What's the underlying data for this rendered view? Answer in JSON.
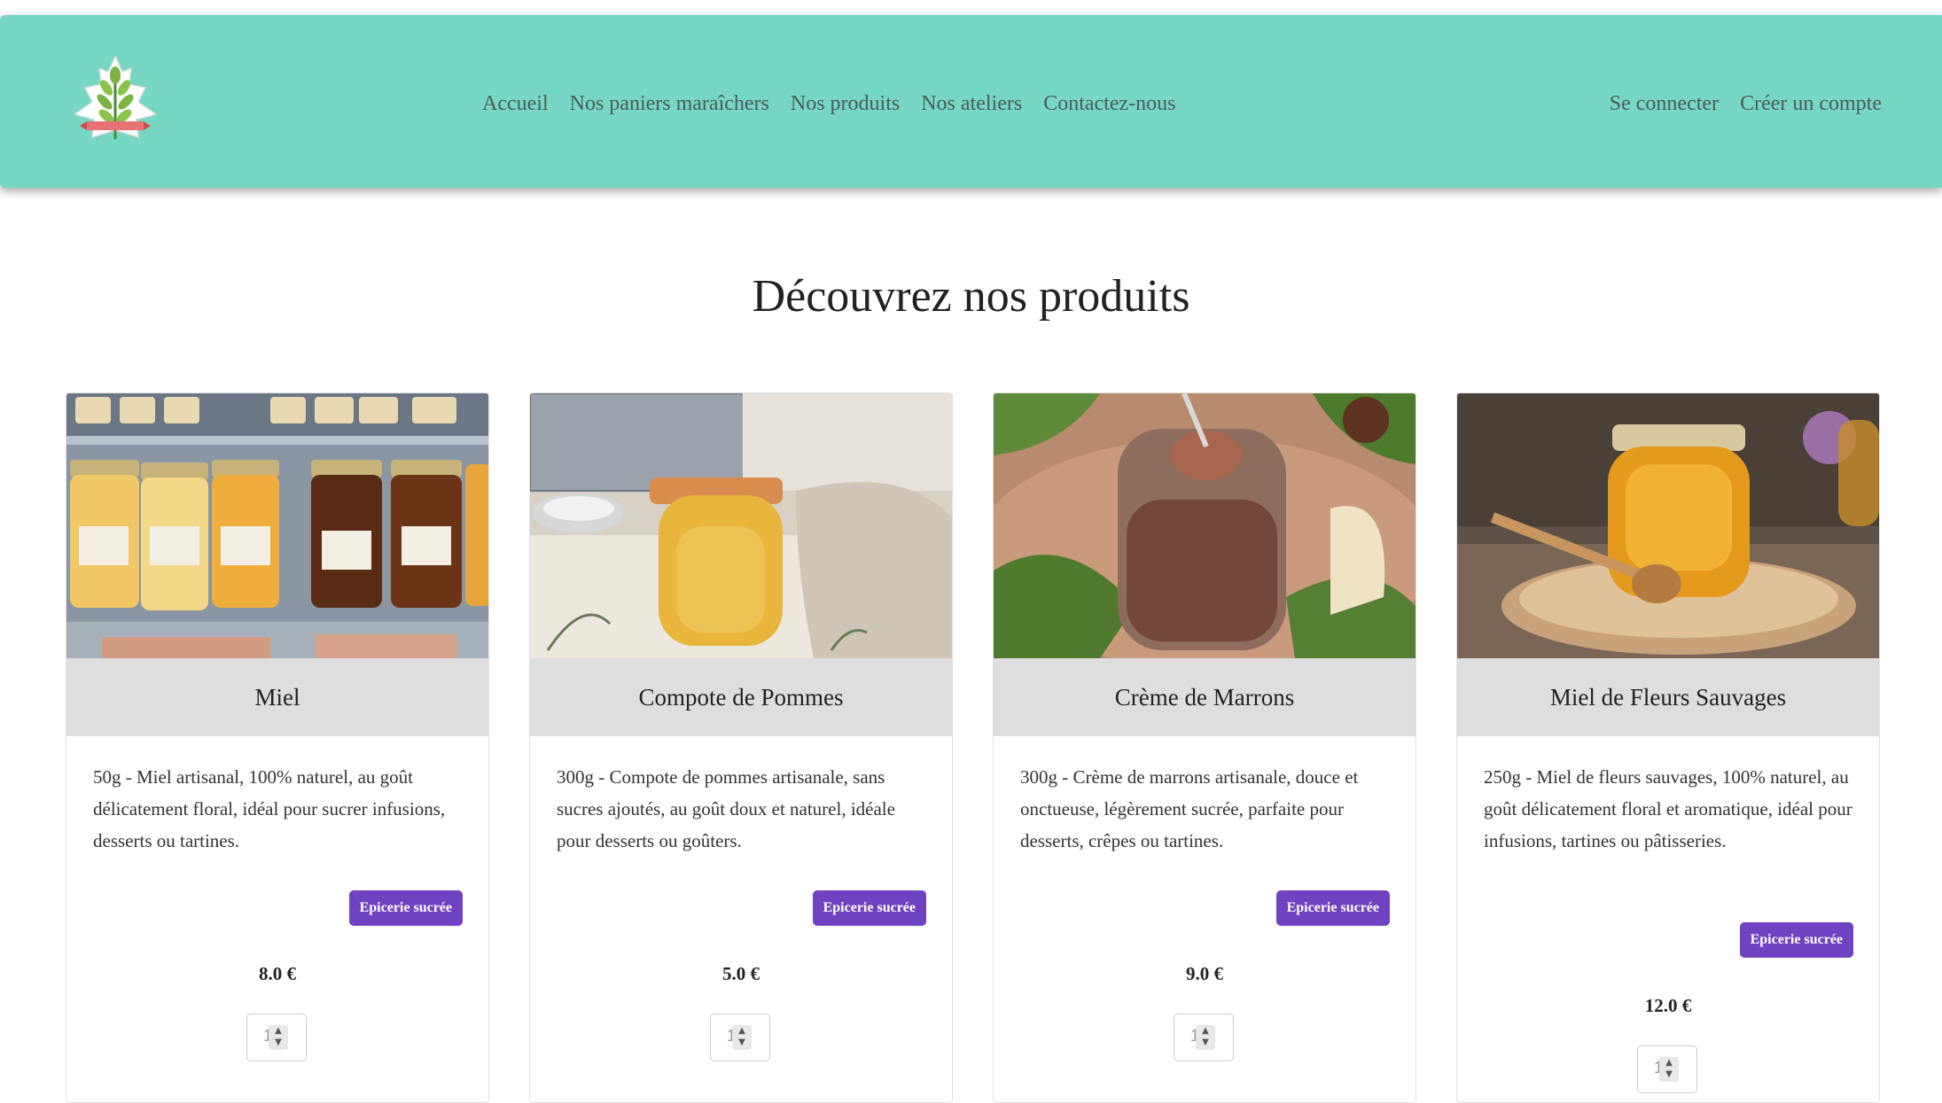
{
  "nav": {
    "logo_icon": "leaf-logo-icon",
    "links": [
      "Accueil",
      "Nos paniers maraîchers",
      "Nos produits",
      "Nos ateliers",
      "Contactez-nous"
    ],
    "auth": [
      "Se connecter",
      "Créer un compte"
    ]
  },
  "page_title": "Découvrez nos produits",
  "colors": {
    "navbar": "#76d7c4",
    "badge": "#6f42c1",
    "card_header": "#dedede"
  },
  "products": [
    {
      "name": "Miel",
      "description": "50g - Miel artisanal, 100% naturel, au goût délicatement floral, idéal pour sucrer infusions, desserts ou tartines.",
      "category": "Epicerie sucrée",
      "price": "8.0 €",
      "quantity": "1",
      "image": "honey-jars-photo"
    },
    {
      "name": "Compote de Pommes",
      "description": "300g - Compote de pommes artisanale, sans sucres ajoutés, au goût doux et naturel, idéale pour desserts ou goûters.",
      "category": "Epicerie sucrée",
      "price": "5.0 €",
      "quantity": "1",
      "image": "apple-compote-jar-photo"
    },
    {
      "name": "Crème de Marrons",
      "description": "300g - Crème de marrons artisanale, douce et onctueuse, légèrement sucrée, parfaite pour desserts, crêpes ou tartines.",
      "category": "Epicerie sucrée",
      "price": "9.0 €",
      "quantity": "1",
      "image": "chestnut-cream-jar-photo"
    },
    {
      "name": "Miel de Fleurs Sauvages",
      "description": "250g - Miel de fleurs sauvages, 100% naturel, au goût délicatement floral et aromatique, idéal pour infusions, tartines ou pâtisseries.",
      "category": "Epicerie sucrée",
      "price": "12.0 €",
      "quantity": "1",
      "image": "wildflower-honey-jar-photo"
    }
  ]
}
